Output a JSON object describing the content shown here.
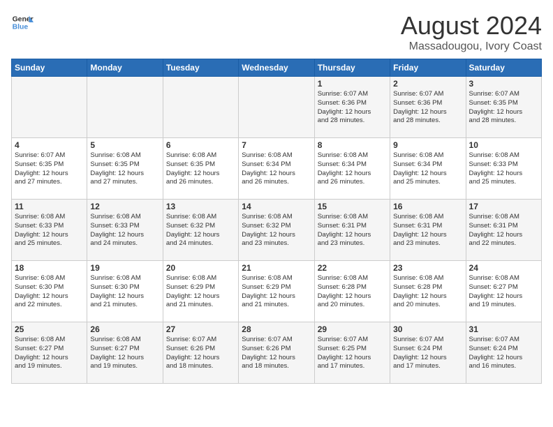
{
  "logo": {
    "line1": "General",
    "line2": "Blue"
  },
  "title": "August 2024",
  "subtitle": "Massadougou, Ivory Coast",
  "weekdays": [
    "Sunday",
    "Monday",
    "Tuesday",
    "Wednesday",
    "Thursday",
    "Friday",
    "Saturday"
  ],
  "weeks": [
    [
      {
        "day": "",
        "detail": ""
      },
      {
        "day": "",
        "detail": ""
      },
      {
        "day": "",
        "detail": ""
      },
      {
        "day": "",
        "detail": ""
      },
      {
        "day": "1",
        "detail": "Sunrise: 6:07 AM\nSunset: 6:36 PM\nDaylight: 12 hours\nand 28 minutes."
      },
      {
        "day": "2",
        "detail": "Sunrise: 6:07 AM\nSunset: 6:36 PM\nDaylight: 12 hours\nand 28 minutes."
      },
      {
        "day": "3",
        "detail": "Sunrise: 6:07 AM\nSunset: 6:35 PM\nDaylight: 12 hours\nand 28 minutes."
      }
    ],
    [
      {
        "day": "4",
        "detail": "Sunrise: 6:07 AM\nSunset: 6:35 PM\nDaylight: 12 hours\nand 27 minutes."
      },
      {
        "day": "5",
        "detail": "Sunrise: 6:08 AM\nSunset: 6:35 PM\nDaylight: 12 hours\nand 27 minutes."
      },
      {
        "day": "6",
        "detail": "Sunrise: 6:08 AM\nSunset: 6:35 PM\nDaylight: 12 hours\nand 26 minutes."
      },
      {
        "day": "7",
        "detail": "Sunrise: 6:08 AM\nSunset: 6:34 PM\nDaylight: 12 hours\nand 26 minutes."
      },
      {
        "day": "8",
        "detail": "Sunrise: 6:08 AM\nSunset: 6:34 PM\nDaylight: 12 hours\nand 26 minutes."
      },
      {
        "day": "9",
        "detail": "Sunrise: 6:08 AM\nSunset: 6:34 PM\nDaylight: 12 hours\nand 25 minutes."
      },
      {
        "day": "10",
        "detail": "Sunrise: 6:08 AM\nSunset: 6:33 PM\nDaylight: 12 hours\nand 25 minutes."
      }
    ],
    [
      {
        "day": "11",
        "detail": "Sunrise: 6:08 AM\nSunset: 6:33 PM\nDaylight: 12 hours\nand 25 minutes."
      },
      {
        "day": "12",
        "detail": "Sunrise: 6:08 AM\nSunset: 6:33 PM\nDaylight: 12 hours\nand 24 minutes."
      },
      {
        "day": "13",
        "detail": "Sunrise: 6:08 AM\nSunset: 6:32 PM\nDaylight: 12 hours\nand 24 minutes."
      },
      {
        "day": "14",
        "detail": "Sunrise: 6:08 AM\nSunset: 6:32 PM\nDaylight: 12 hours\nand 23 minutes."
      },
      {
        "day": "15",
        "detail": "Sunrise: 6:08 AM\nSunset: 6:31 PM\nDaylight: 12 hours\nand 23 minutes."
      },
      {
        "day": "16",
        "detail": "Sunrise: 6:08 AM\nSunset: 6:31 PM\nDaylight: 12 hours\nand 23 minutes."
      },
      {
        "day": "17",
        "detail": "Sunrise: 6:08 AM\nSunset: 6:31 PM\nDaylight: 12 hours\nand 22 minutes."
      }
    ],
    [
      {
        "day": "18",
        "detail": "Sunrise: 6:08 AM\nSunset: 6:30 PM\nDaylight: 12 hours\nand 22 minutes."
      },
      {
        "day": "19",
        "detail": "Sunrise: 6:08 AM\nSunset: 6:30 PM\nDaylight: 12 hours\nand 21 minutes."
      },
      {
        "day": "20",
        "detail": "Sunrise: 6:08 AM\nSunset: 6:29 PM\nDaylight: 12 hours\nand 21 minutes."
      },
      {
        "day": "21",
        "detail": "Sunrise: 6:08 AM\nSunset: 6:29 PM\nDaylight: 12 hours\nand 21 minutes."
      },
      {
        "day": "22",
        "detail": "Sunrise: 6:08 AM\nSunset: 6:28 PM\nDaylight: 12 hours\nand 20 minutes."
      },
      {
        "day": "23",
        "detail": "Sunrise: 6:08 AM\nSunset: 6:28 PM\nDaylight: 12 hours\nand 20 minutes."
      },
      {
        "day": "24",
        "detail": "Sunrise: 6:08 AM\nSunset: 6:27 PM\nDaylight: 12 hours\nand 19 minutes."
      }
    ],
    [
      {
        "day": "25",
        "detail": "Sunrise: 6:08 AM\nSunset: 6:27 PM\nDaylight: 12 hours\nand 19 minutes."
      },
      {
        "day": "26",
        "detail": "Sunrise: 6:08 AM\nSunset: 6:27 PM\nDaylight: 12 hours\nand 19 minutes."
      },
      {
        "day": "27",
        "detail": "Sunrise: 6:07 AM\nSunset: 6:26 PM\nDaylight: 12 hours\nand 18 minutes."
      },
      {
        "day": "28",
        "detail": "Sunrise: 6:07 AM\nSunset: 6:26 PM\nDaylight: 12 hours\nand 18 minutes."
      },
      {
        "day": "29",
        "detail": "Sunrise: 6:07 AM\nSunset: 6:25 PM\nDaylight: 12 hours\nand 17 minutes."
      },
      {
        "day": "30",
        "detail": "Sunrise: 6:07 AM\nSunset: 6:24 PM\nDaylight: 12 hours\nand 17 minutes."
      },
      {
        "day": "31",
        "detail": "Sunrise: 6:07 AM\nSunset: 6:24 PM\nDaylight: 12 hours\nand 16 minutes."
      }
    ]
  ]
}
